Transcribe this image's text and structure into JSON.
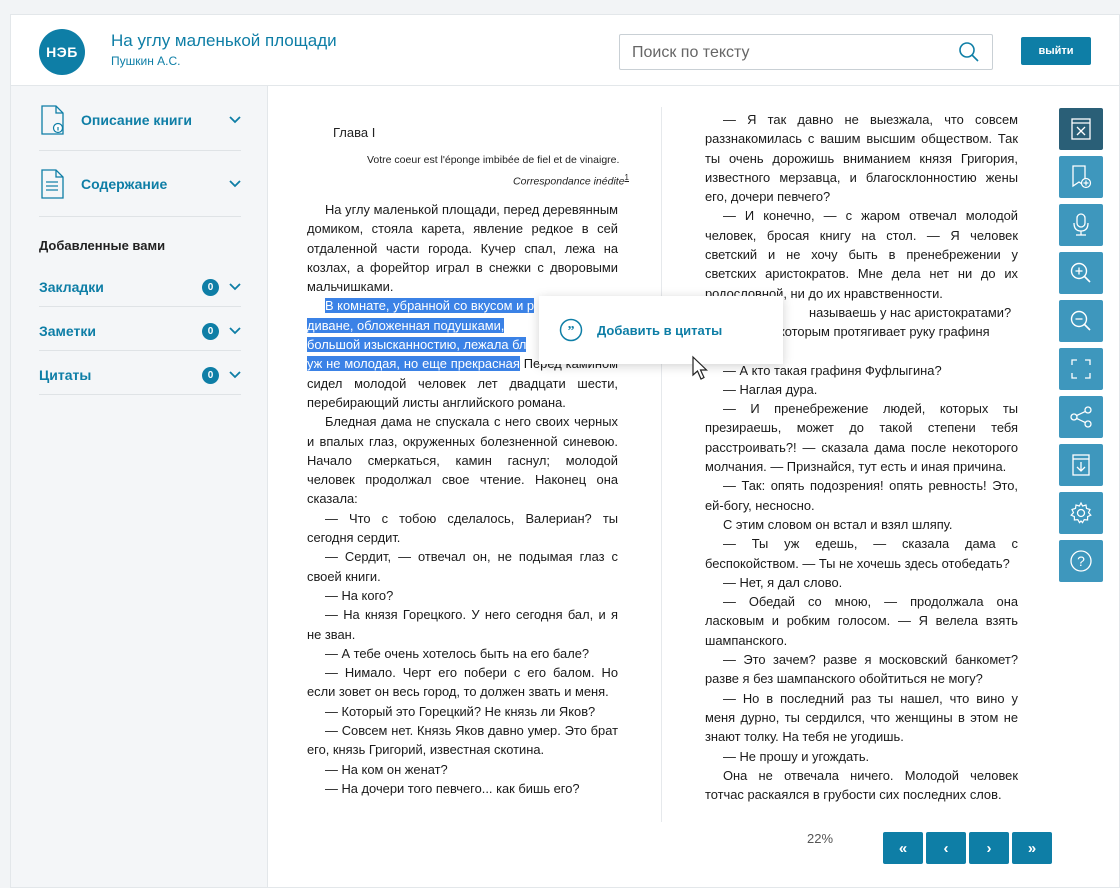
{
  "header": {
    "logo": "НЭБ",
    "book_title": "На углу маленькой площади",
    "book_author": "Пушкин А.С.",
    "search_placeholder": "Поиск по тексту",
    "logout_label": "выйти"
  },
  "sidebar": {
    "description_label": "Описание книги",
    "contents_label": "Содержание",
    "added_heading": "Добавленные вами",
    "items": [
      {
        "label": "Закладки",
        "count": "0"
      },
      {
        "label": "Заметки",
        "count": "0"
      },
      {
        "label": "Цитаты",
        "count": "0"
      }
    ]
  },
  "left_page": {
    "chapter": "Глава I",
    "epigraph_1": "Votre coeur est l'éponge imbibée de fiel et de vinaigre.",
    "epigraph_2": "Correspondance inédite",
    "epigraph_note": "1",
    "p1": "На углу маленькой площади, перед деревянным домиком, стояла карета, явление редкое в сей отдаленной части города. Кучер спал, лежа на козлах, а форейтор играл в снежки с дворовыми мальчишками.",
    "p2_selected_1": "В комнате, убранной со вкусом и р",
    "p2_selected_2": "диване, обложенная подушками,",
    "p2_selected_3": "большой изысканностию, лежала бл",
    "p2_selected_4": "уж не молодая, но еще прекрасная",
    "p2_rest": " Перед камином сидел молодой человек лет двадцати шести, перебирающий листы английского романа.",
    "p3": "Бледная дама не спускала с него своих черных и впалых глаз, окруженных болезненной синевою. Начало смеркаться, камин гаснул; молодой человек продолжал свое чтение. Наконец она сказала:",
    "p4": "— Что с тобою сделалось, Валериан? ты сегодня сердит.",
    "p5": "— Сердит, — отвечал он, не подымая глаз с своей книги.",
    "p6": "— На кого?",
    "p7": "— На князя Горецкого. У него сегодня бал, и я не зван.",
    "p8": "— А тебе очень хотелось быть на его бале?",
    "p9": "— Нимало. Черт его побери с его балом. Но если зовет он весь город, то должен звать и меня.",
    "p10": "— Который это Горецкий? Не князь ли Яков?",
    "p11": "— Совсем нет. Князь Яков давно умер. Это брат его, князь Григорий, известная скотина.",
    "p12": "— На ком он женат?",
    "p13": "— На дочери того певчего... как бишь его?"
  },
  "right_page": {
    "p1": "— Я так давно не выезжала, что совсем раззнакомилась с вашим высшим обществом. Так ты очень дорожишь вниманием князя Григория, известного мерзавца, и благосклонностию жены его, дочери певчего?",
    "p2": "— И конечно, — с жаром отвечал молодой человек, бросая книгу на стол. — Я человек светский и не хочу быть в пренебрежении у светских аристократов. Мне дела нет ни до их родословной, ни до их нравственности.",
    "p3_visible": "называешь у нас аристократами?",
    "p3b_visible": "которым протягивает руку графиня",
    "p4": "— А кто такая графиня Фуфлыгина?",
    "p5": "— Наглая дура.",
    "p6": "— И пренебрежение людей, которых ты презираешь, может до такой степени тебя расстроивать?! — сказала дама после некоторого молчания. — Признайся, тут есть и иная причина.",
    "p7": "— Так: опять подозрения! опять ревность! Это, ей-богу, несносно.",
    "p8": "С этим словом он встал и взял шляпу.",
    "p9": "— Ты уж едешь, — сказала дама с беспокойством. — Ты не хочешь здесь отобедать?",
    "p10": "— Нет, я дал слово.",
    "p11": "— Обедай со мною, — продолжала она ласковым и робким голосом. — Я велела взять шампанского.",
    "p12": "— Это зачем? разве я московский банкомет? разве я без шампанского обойтиться не могу?",
    "p13": "— Но в последний раз ты нашел, что вино у меня дурно, ты сердился, что женщины в этом не знают толку. На тебя не угодишь.",
    "p14": "— Не прошу и угождать.",
    "p15": "Она не отвечала ничего. Молодой человек тотчас раскаялся в грубости сих последних слов."
  },
  "popup": {
    "label": "Добавить в цитаты",
    "icon": "quote-icon"
  },
  "toolbar": {
    "buttons": [
      "close-panel-icon",
      "add-bookmark-icon",
      "microphone-icon",
      "zoom-in-icon",
      "zoom-out-icon",
      "fullscreen-icon",
      "share-icon",
      "download-icon",
      "settings-icon",
      "help-icon"
    ]
  },
  "footer": {
    "progress": "22%",
    "first": "«",
    "prev": "‹",
    "next": "›",
    "last": "»"
  },
  "colors": {
    "accent": "#0e7ea6",
    "toolbar": "#3e97bd",
    "toolbar_active": "#2a5f77",
    "highlight": "#3b82e6"
  }
}
